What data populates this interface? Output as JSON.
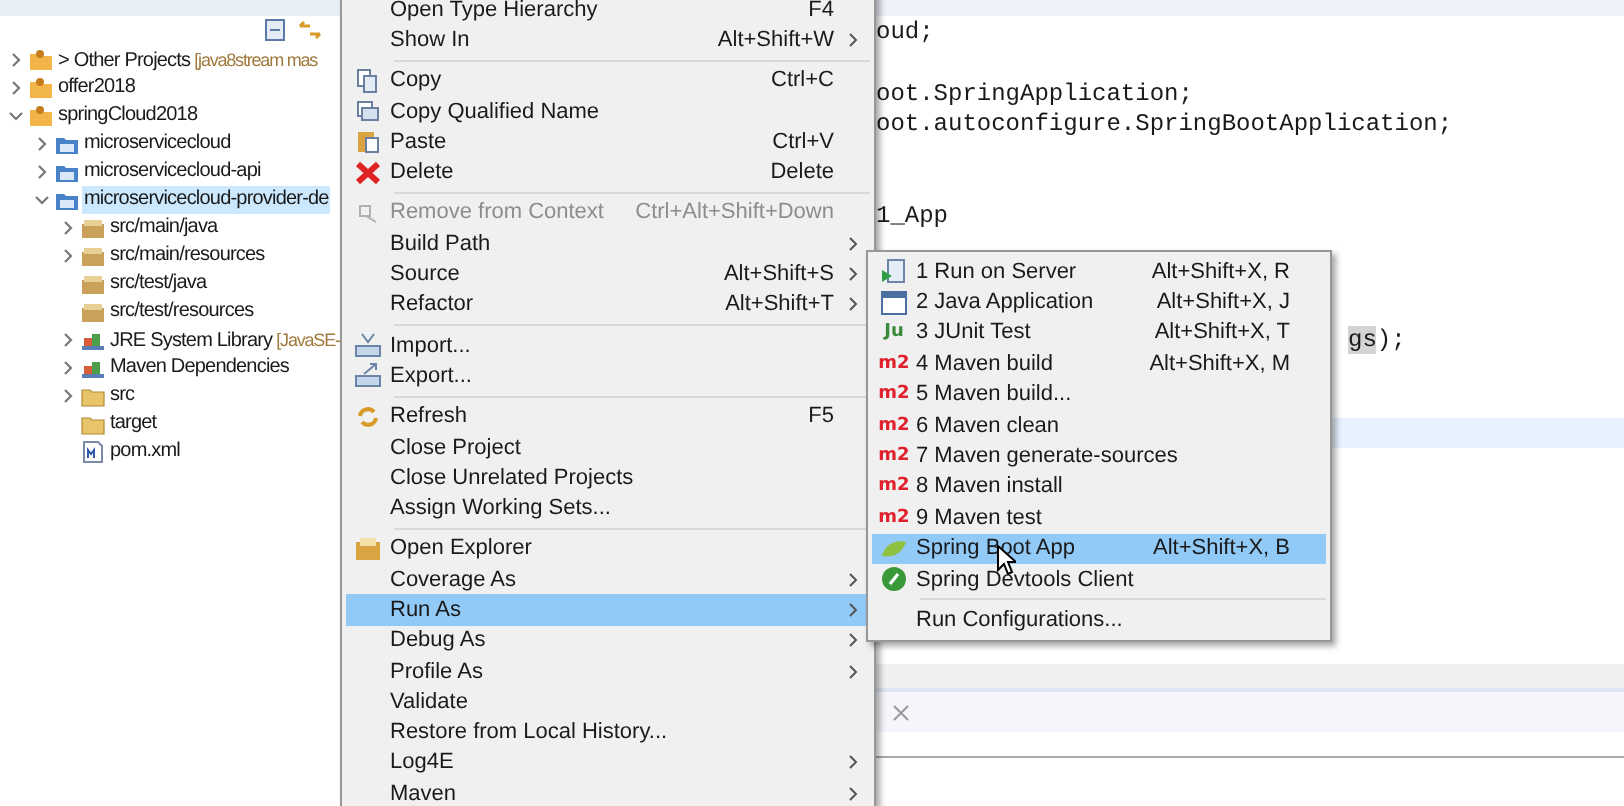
{
  "explorer": {
    "tree": [
      {
        "label": "> Other Projects",
        "note": "[java8stream mas",
        "kind": "working-set",
        "expanded": false
      },
      {
        "label": "offer2018",
        "kind": "working-set",
        "expanded": false
      },
      {
        "label": "springCloud2018",
        "kind": "working-set",
        "expanded": true,
        "children": [
          {
            "label": "microservicecloud",
            "kind": "project",
            "expanded": false
          },
          {
            "label": "microservicecloud-api",
            "kind": "project",
            "expanded": false
          },
          {
            "label": "microservicecloud-provider-de",
            "kind": "project",
            "expanded": true,
            "selected": true,
            "children": [
              {
                "label": "src/main/java",
                "kind": "package-folder",
                "expanded": false
              },
              {
                "label": "src/main/resources",
                "kind": "package-folder",
                "expanded": false
              },
              {
                "label": "src/test/java",
                "kind": "package-folder"
              },
              {
                "label": "src/test/resources",
                "kind": "package-folder"
              },
              {
                "label": "JRE System Library",
                "note": "[JavaSE-",
                "kind": "library",
                "expanded": false
              },
              {
                "label": "Maven Dependencies",
                "kind": "library",
                "expanded": false
              },
              {
                "label": "src",
                "kind": "folder",
                "expanded": false
              },
              {
                "label": "target",
                "kind": "folder"
              },
              {
                "label": "pom.xml",
                "kind": "maven-file"
              }
            ]
          }
        ]
      }
    ]
  },
  "editor": {
    "lines": [
      {
        "kind": "code",
        "text": "oud;"
      },
      {
        "kind": "blank"
      },
      {
        "kind": "code",
        "text": "oot.SpringApplication;"
      },
      {
        "kind": "code",
        "text": "oot.autoconfigure.SpringBootApplication;"
      },
      {
        "kind": "blank"
      },
      {
        "kind": "blank"
      },
      {
        "kind": "code",
        "text": "1_App"
      },
      {
        "kind": "blank"
      },
      {
        "kind": "blank"
      },
      {
        "kind": "blank"
      },
      {
        "kind": "tail",
        "segments": [
          {
            "text": "gs",
            "marked": true
          },
          {
            "text": ");",
            "marked": false
          }
        ]
      },
      {
        "kind": "blank"
      },
      {
        "kind": "blank"
      },
      {
        "kind": "blank",
        "current": true
      }
    ]
  },
  "context_menu": {
    "items": [
      {
        "kind": "plain",
        "label": "Open Type Hierarchy",
        "shortcut": "F4"
      },
      {
        "kind": "plain",
        "label": "Show In",
        "shortcut": "Alt+Shift+W",
        "submenu": true
      },
      {
        "kind": "separator"
      },
      {
        "kind": "copy",
        "label": "Copy",
        "shortcut": "Ctrl+C"
      },
      {
        "kind": "copy-name",
        "label": "Copy Qualified Name"
      },
      {
        "kind": "paste",
        "label": "Paste",
        "shortcut": "Ctrl+V"
      },
      {
        "kind": "delete",
        "label": "Delete",
        "shortcut": "Delete"
      },
      {
        "kind": "separator"
      },
      {
        "kind": "remove",
        "label": "Remove from Context",
        "shortcut": "Ctrl+Alt+Shift+Down",
        "disabled": true
      },
      {
        "kind": "plain",
        "label": "Build Path",
        "submenu": true
      },
      {
        "kind": "plain",
        "label": "Source",
        "shortcut": "Alt+Shift+S",
        "submenu": true
      },
      {
        "kind": "plain",
        "label": "Refactor",
        "shortcut": "Alt+Shift+T",
        "submenu": true
      },
      {
        "kind": "separator"
      },
      {
        "kind": "import",
        "label": "Import..."
      },
      {
        "kind": "export",
        "label": "Export..."
      },
      {
        "kind": "separator"
      },
      {
        "kind": "refresh",
        "label": "Refresh",
        "shortcut": "F5"
      },
      {
        "kind": "plain",
        "label": "Close Project"
      },
      {
        "kind": "plain",
        "label": "Close Unrelated Projects"
      },
      {
        "kind": "plain",
        "label": "Assign Working Sets..."
      },
      {
        "kind": "separator"
      },
      {
        "kind": "explorer",
        "label": "Open Explorer"
      },
      {
        "kind": "plain",
        "label": "Coverage As",
        "submenu": true
      },
      {
        "kind": "plain",
        "label": "Run As",
        "submenu": true,
        "selected": true
      },
      {
        "kind": "plain",
        "label": "Debug As",
        "submenu": true
      },
      {
        "kind": "plain",
        "label": "Profile As",
        "submenu": true
      },
      {
        "kind": "plain",
        "label": "Validate"
      },
      {
        "kind": "plain",
        "label": "Restore from Local History..."
      },
      {
        "kind": "plain",
        "label": "Log4E",
        "submenu": true
      },
      {
        "kind": "plain",
        "label": "Maven",
        "submenu": true
      }
    ]
  },
  "run_as_menu": {
    "items": [
      {
        "kind": "server",
        "label": "1 Run on Server",
        "shortcut": "Alt+Shift+X, R"
      },
      {
        "kind": "java-app",
        "label": "2 Java Application",
        "shortcut": "Alt+Shift+X, J"
      },
      {
        "kind": "junit",
        "label": "3 JUnit Test",
        "shortcut": "Alt+Shift+X, T",
        "icon_text": "Ju"
      },
      {
        "kind": "maven",
        "label": "4 Maven build",
        "shortcut": "Alt+Shift+X, M",
        "icon_text": "m2"
      },
      {
        "kind": "maven",
        "label": "5 Maven build...",
        "icon_text": "m2"
      },
      {
        "kind": "maven",
        "label": "6 Maven clean",
        "icon_text": "m2"
      },
      {
        "kind": "maven",
        "label": "7 Maven generate-sources",
        "icon_text": "m2"
      },
      {
        "kind": "maven",
        "label": "8 Maven install",
        "icon_text": "m2"
      },
      {
        "kind": "maven",
        "label": "9 Maven test",
        "icon_text": "m2"
      },
      {
        "kind": "spring",
        "label": "Spring Boot App",
        "shortcut": "Alt+Shift+X, B",
        "selected": true
      },
      {
        "kind": "devtools",
        "label": "Spring Devtools Client"
      },
      {
        "kind": "separator"
      },
      {
        "kind": "plain",
        "label": "Run Configurations..."
      }
    ]
  }
}
